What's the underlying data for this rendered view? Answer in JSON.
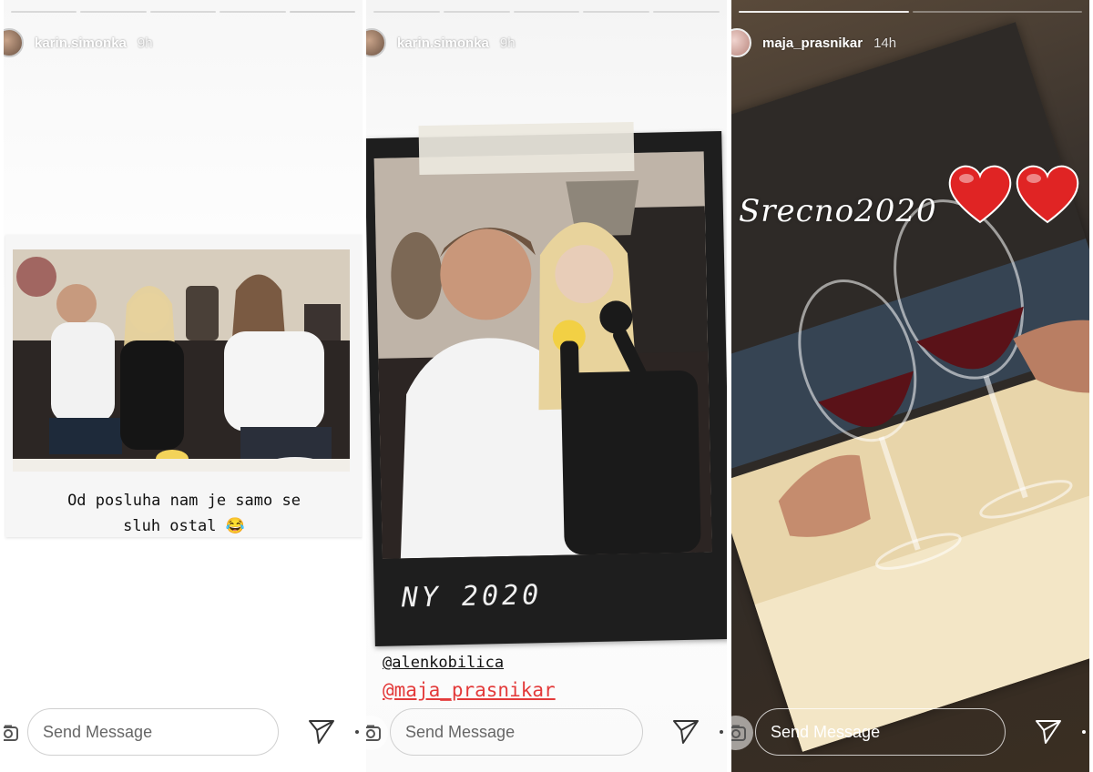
{
  "stories": [
    {
      "username": "karin.simonka",
      "time": "9h",
      "caption_line1": "Od posluha nam je samo se",
      "caption_line2": "sluh ostal",
      "caption_emoji": "😂",
      "send_placeholder": "Send Message",
      "progress_segments": 5,
      "progress_done": 4
    },
    {
      "username": "karin.simonka",
      "time": "9h",
      "photo_label": "NY 2020",
      "mention_1": "@alenkobilica",
      "mention_2": "@maja_prasnikar",
      "send_placeholder": "Send Message",
      "progress_segments": 5,
      "progress_done": 5
    },
    {
      "username": "maja_prasnikar",
      "time": "14h",
      "sticker_text": "Srecno2020",
      "send_placeholder": "Send Message",
      "progress_segments": 2,
      "progress_done": 1
    }
  ],
  "icons": {
    "camera": "camera-icon",
    "send": "paper-plane-icon",
    "more": "more-dot-icon",
    "heart": "red-heart-icon"
  },
  "colors": {
    "mention_highlight": "#e33a3a",
    "heart": "#e02424"
  }
}
